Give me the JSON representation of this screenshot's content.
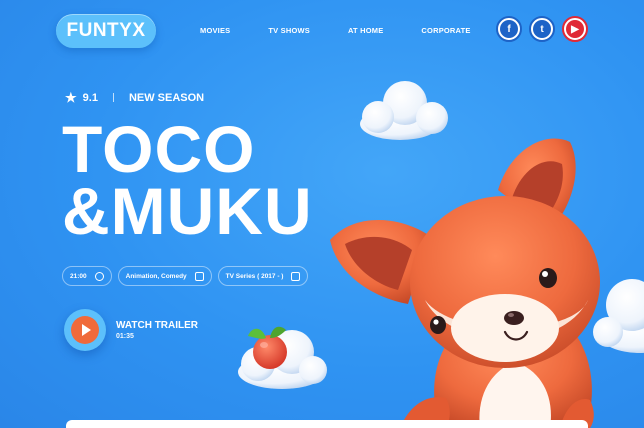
{
  "brand": {
    "logo": "FUNTYX"
  },
  "nav": {
    "items": [
      "MOVIES",
      "TV SHOWS",
      "AT HOME",
      "CORPORATE"
    ]
  },
  "social": [
    {
      "name": "facebook-icon",
      "glyph": "f"
    },
    {
      "name": "twitter-icon",
      "glyph": "t"
    },
    {
      "name": "youtube-icon",
      "glyph": "▶"
    }
  ],
  "hero": {
    "rating": "9.1",
    "badge": "NEW SEASON",
    "title_line1": "TOCO",
    "title_line2": "&MUKU",
    "chips": [
      {
        "label": "21:00",
        "icon": "clock-icon"
      },
      {
        "label": "Animation, Comedy",
        "icon": "tv-icon"
      },
      {
        "label": "TV Series ( 2017 - )",
        "icon": "play-icon"
      }
    ],
    "watch_label": "WATCH TRAILER",
    "watch_duration": "01:35"
  },
  "colors": {
    "background": "#2f93f2",
    "accent": "#f06a3a",
    "logo_bg": "#5cc0fb",
    "fox": "#ee6a3e"
  }
}
